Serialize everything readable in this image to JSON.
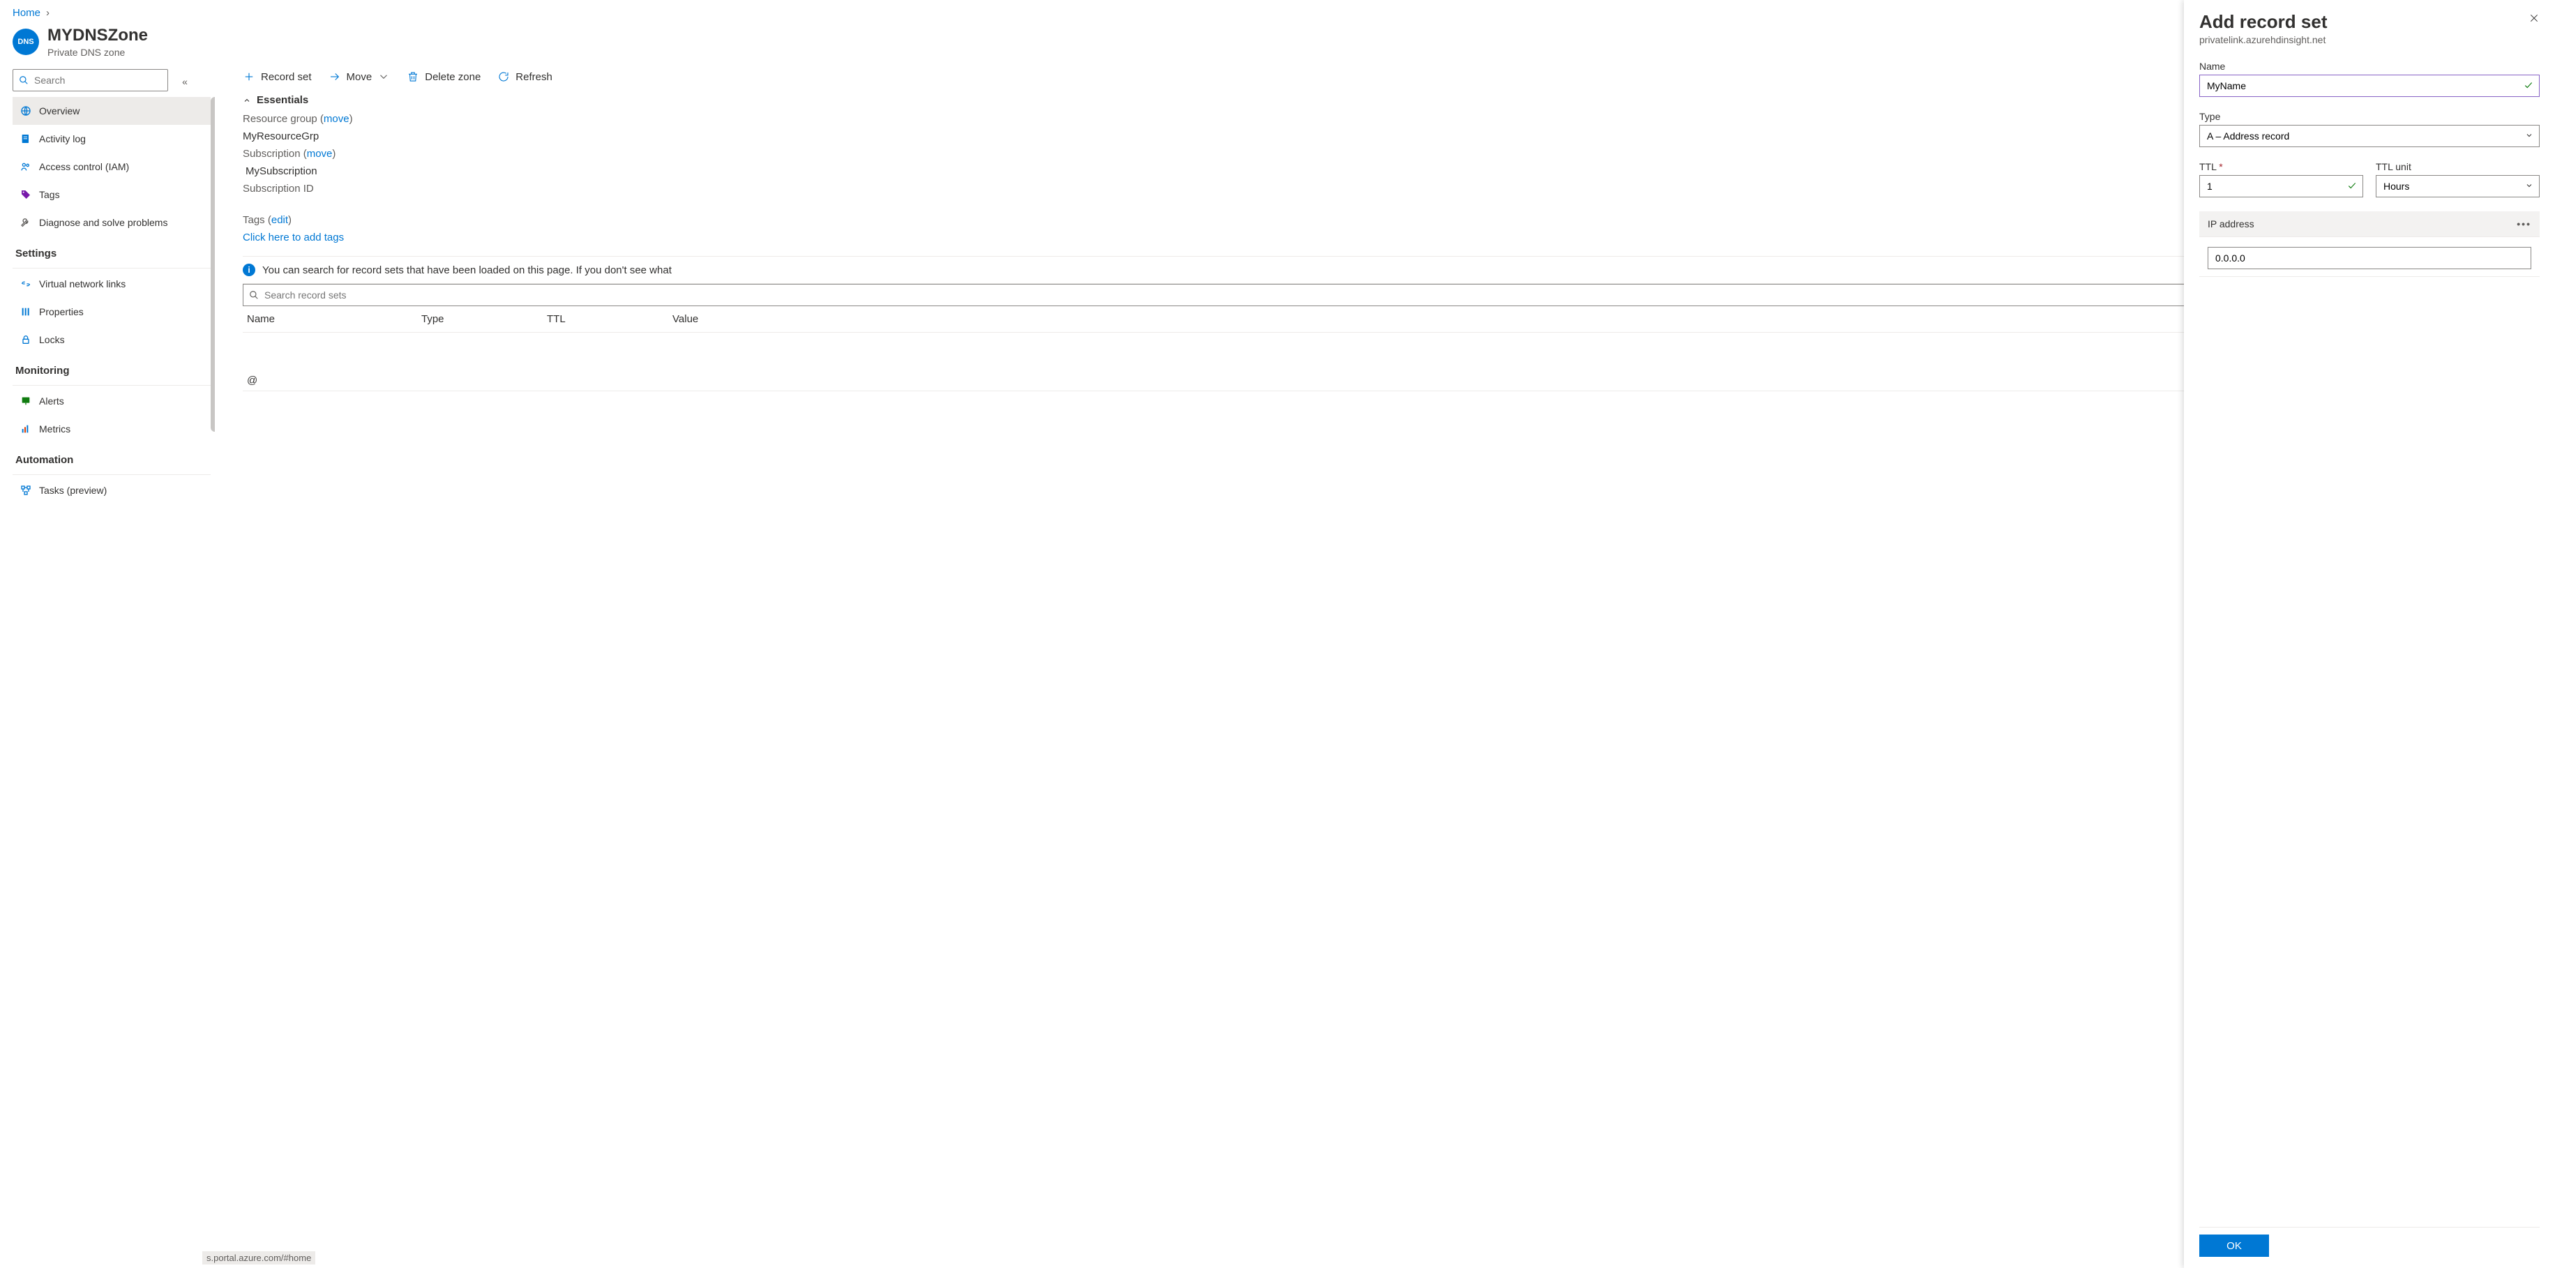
{
  "breadcrumb": {
    "home": "Home"
  },
  "header": {
    "badge": "DNS",
    "title": "MYDNSZone",
    "subtitle": "Private DNS zone"
  },
  "sidebar": {
    "search_placeholder": "Search",
    "items": [
      {
        "label": "Overview"
      },
      {
        "label": "Activity log"
      },
      {
        "label": "Access control (IAM)"
      },
      {
        "label": "Tags"
      },
      {
        "label": "Diagnose and solve problems"
      }
    ],
    "sections": {
      "settings": {
        "title": "Settings",
        "items": [
          {
            "label": "Virtual network links"
          },
          {
            "label": "Properties"
          },
          {
            "label": "Locks"
          }
        ]
      },
      "monitoring": {
        "title": "Monitoring",
        "items": [
          {
            "label": "Alerts"
          },
          {
            "label": "Metrics"
          }
        ]
      },
      "automation": {
        "title": "Automation",
        "items": [
          {
            "label": "Tasks (preview)"
          }
        ]
      }
    }
  },
  "toolbar": {
    "record_set": "Record set",
    "move": "Move",
    "delete_zone": "Delete zone",
    "refresh": "Refresh"
  },
  "essentials": {
    "title": "Essentials",
    "rg_label": "Resource group",
    "rg_move": "move",
    "rg_value": "MyResourceGrp",
    "sub_label": "Subscription",
    "sub_move": "move",
    "sub_value": "MySubscription",
    "sub_id_label": "Subscription ID",
    "tags_label": "Tags",
    "tags_edit": "edit",
    "tags_link": "Click here to add tags"
  },
  "info_text": "You can search for record sets that have been loaded on this page. If you don't see what",
  "records": {
    "search_placeholder": "Search record sets",
    "columns": {
      "name": "Name",
      "type": "Type",
      "ttl": "TTL",
      "value": "Value"
    },
    "rows": [
      {
        "name": "@"
      }
    ]
  },
  "status_url": "s.portal.azure.com/#home",
  "panel": {
    "title": "Add record set",
    "subtitle": "privatelink.azurehdinsight.net",
    "name_label": "Name",
    "name_value": "MyName",
    "type_label": "Type",
    "type_value": "A – Address record",
    "ttl_label": "TTL",
    "ttl_value": "1",
    "ttl_unit_label": "TTL unit",
    "ttl_unit_value": "Hours",
    "ip_label": "IP address",
    "ip_value": "0.0.0.0",
    "ok": "OK"
  }
}
